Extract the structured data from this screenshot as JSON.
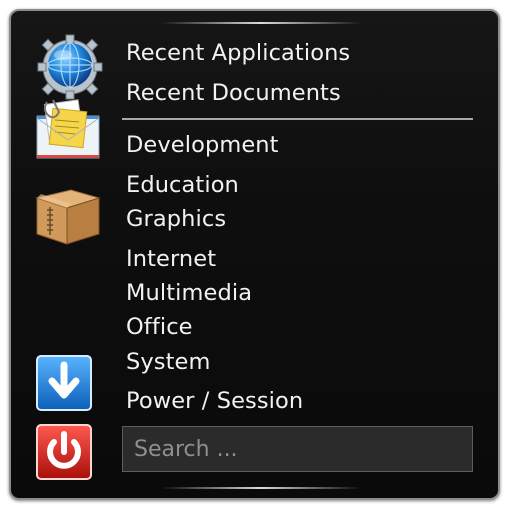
{
  "menu": {
    "items": [
      {
        "label": "Recent Applications"
      },
      {
        "label": "Recent Documents"
      },
      {
        "label": "Development"
      },
      {
        "label": "Education"
      },
      {
        "label": "Graphics"
      },
      {
        "label": "Internet"
      },
      {
        "label": "Multimedia"
      },
      {
        "label": "Office"
      },
      {
        "label": "System"
      },
      {
        "label": "Power / Session"
      }
    ]
  },
  "search": {
    "placeholder": "Search ..."
  },
  "icons": [
    {
      "name": "globe-gear-icon",
      "color": "#2a8fe0"
    },
    {
      "name": "mail-documents-icon",
      "color": "#f2d04a"
    },
    {
      "name": "package-box-icon",
      "color": "#c8935a"
    },
    {
      "name": "download-arrow-icon",
      "color": "#1e7fd8"
    },
    {
      "name": "power-icon",
      "color": "#d4221c"
    }
  ]
}
